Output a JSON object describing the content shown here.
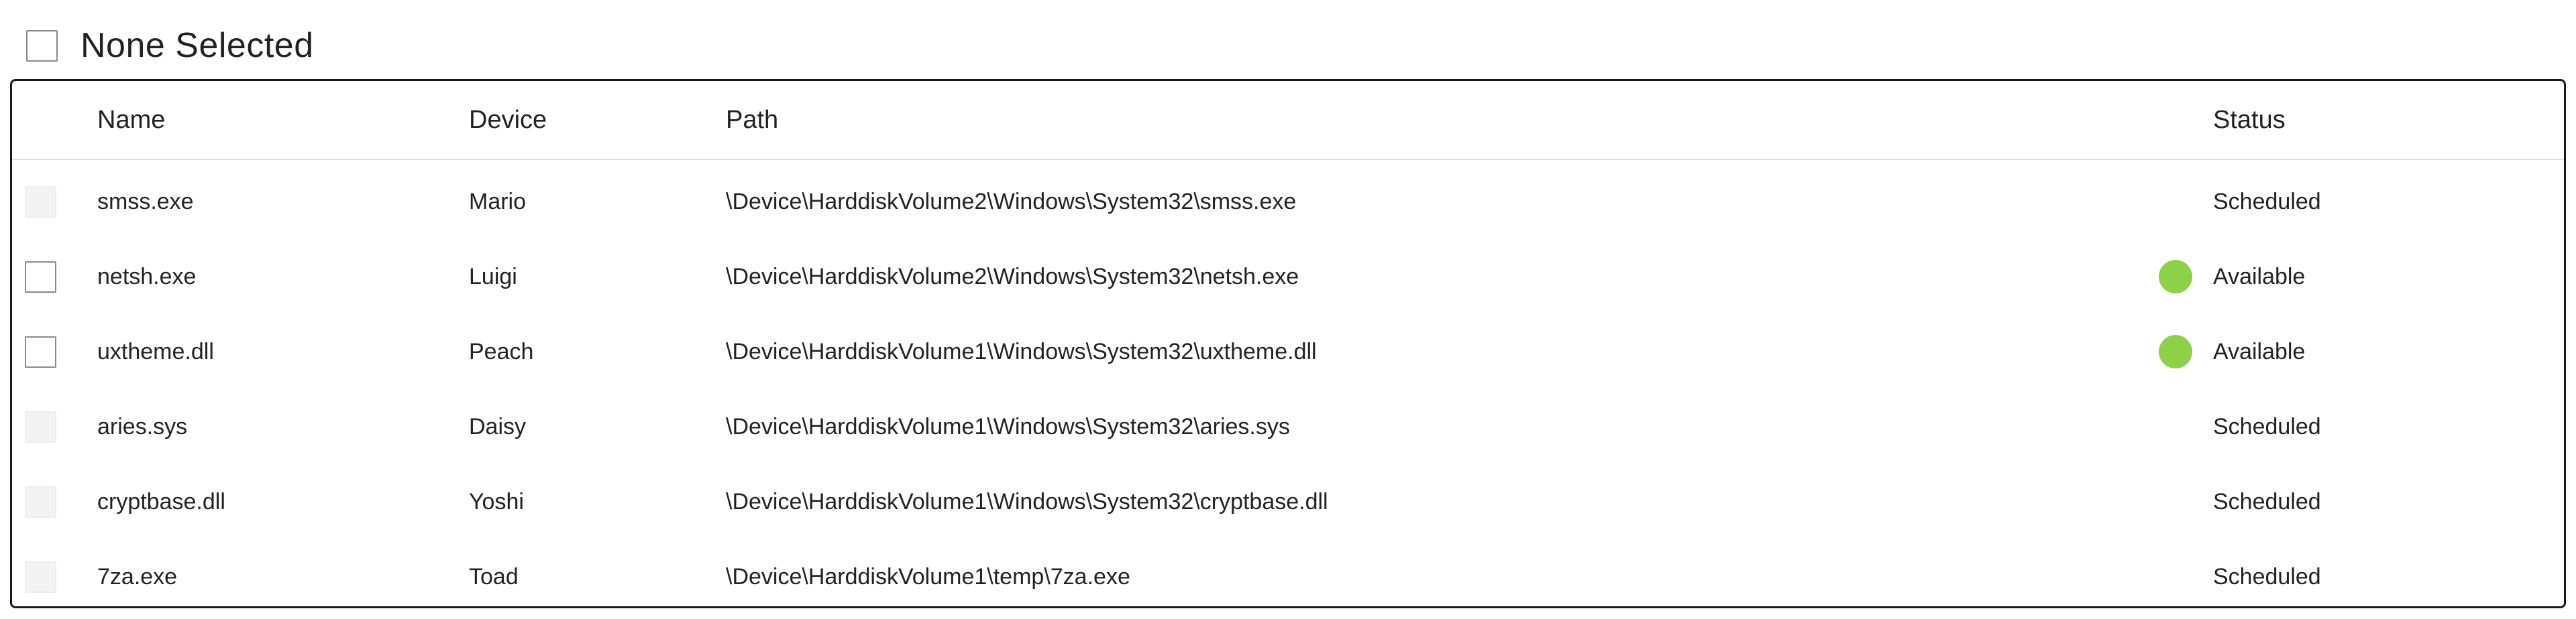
{
  "selection": {
    "label": "None Selected"
  },
  "columns": {
    "name": "Name",
    "device": "Device",
    "path": "Path",
    "status": "Status"
  },
  "rows": [
    {
      "name": "smss.exe",
      "device": "Mario",
      "path": "\\Device\\HarddiskVolume2\\Windows\\System32\\smss.exe",
      "status": "Scheduled",
      "selectable": false,
      "status_dot": false
    },
    {
      "name": "netsh.exe",
      "device": "Luigi",
      "path": "\\Device\\HarddiskVolume2\\Windows\\System32\\netsh.exe",
      "status": "Available",
      "selectable": true,
      "status_dot": true
    },
    {
      "name": "uxtheme.dll",
      "device": "Peach",
      "path": "\\Device\\HarddiskVolume1\\Windows\\System32\\uxtheme.dll",
      "status": "Available",
      "selectable": true,
      "status_dot": true
    },
    {
      "name": "aries.sys",
      "device": "Daisy",
      "path": "\\Device\\HarddiskVolume1\\Windows\\System32\\aries.sys",
      "status": "Scheduled",
      "selectable": false,
      "status_dot": false
    },
    {
      "name": "cryptbase.dll",
      "device": "Yoshi",
      "path": "\\Device\\HarddiskVolume1\\Windows\\System32\\cryptbase.dll",
      "status": "Scheduled",
      "selectable": false,
      "status_dot": false
    },
    {
      "name": "7za.exe",
      "device": "Toad",
      "path": "\\Device\\HarddiskVolume1\\temp\\7za.exe",
      "status": "Scheduled",
      "selectable": false,
      "status_dot": false
    }
  ],
  "colors": {
    "available_dot": "#8dd246",
    "border": "#1a1a1a",
    "header_divider": "#dddddd"
  },
  "icons": {
    "select_all": "checkbox-icon",
    "status_available": "green-dot-icon"
  }
}
